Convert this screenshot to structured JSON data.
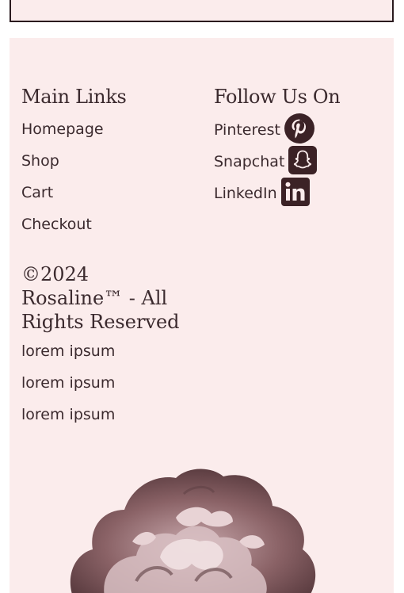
{
  "main_links": {
    "title": "Main Links",
    "items": [
      "Homepage",
      "Shop",
      "Cart",
      "Checkout"
    ]
  },
  "follow": {
    "title": "Follow Us On",
    "items": [
      {
        "label": "Pinterest",
        "icon": "pinterest-icon"
      },
      {
        "label": "Snapchat",
        "icon": "snapchat-icon"
      },
      {
        "label": "LinkedIn",
        "icon": "linkedin-icon"
      }
    ]
  },
  "copyright": "©2024 Rosaline™ - All Rights Reserved",
  "lorem": [
    "lorem ipsum",
    "lorem ipsum",
    "lorem ipsum"
  ],
  "colors": {
    "background": "#fbecec",
    "text": "#3b2a2e",
    "icon": "#3b2226"
  }
}
